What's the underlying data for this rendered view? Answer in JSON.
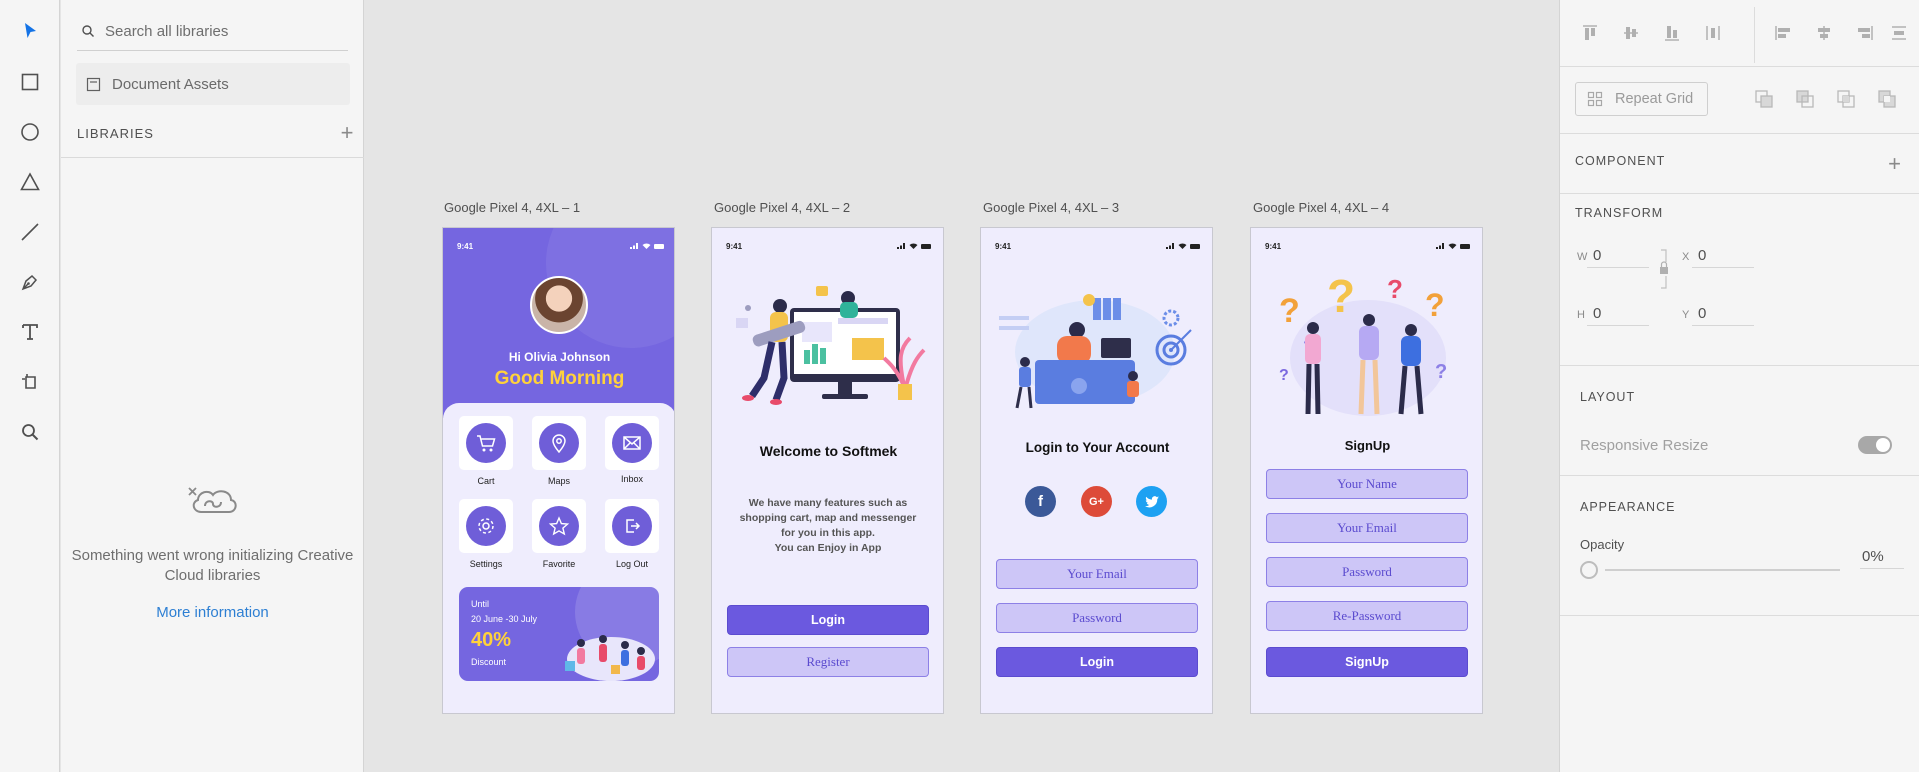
{
  "toolbar": {
    "tools": [
      {
        "name": "select-tool",
        "icon": "arrow-pointer-icon"
      },
      {
        "name": "rectangle-tool",
        "icon": "rectangle-icon"
      },
      {
        "name": "ellipse-tool",
        "icon": "ellipse-icon"
      },
      {
        "name": "polygon-tool",
        "icon": "triangle-icon"
      },
      {
        "name": "line-tool",
        "icon": "line-icon"
      },
      {
        "name": "pen-tool",
        "icon": "pen-icon"
      },
      {
        "name": "text-tool",
        "icon": "text-icon"
      },
      {
        "name": "artboard-tool",
        "icon": "artboard-icon"
      },
      {
        "name": "zoom-tool",
        "icon": "magnifier-icon"
      }
    ],
    "active_color": "#1473e6"
  },
  "libraries": {
    "search_placeholder": "Search all libraries",
    "document_assets": "Document Assets",
    "title": "LIBRARIES",
    "add": "+",
    "error_message": "Something went wrong initializing Creative Cloud libraries",
    "more_info": "More information"
  },
  "artboards": [
    {
      "label": "Google Pixel 4, 4XL – 1",
      "time": "9:41",
      "greeting": "Hi Olivia Johnson",
      "headline": "Good Morning",
      "tiles": [
        {
          "label": "Cart",
          "icon": "cart-icon"
        },
        {
          "label": "Maps",
          "icon": "map-pin-icon"
        },
        {
          "label": "Inbox",
          "icon": "mail-icon"
        },
        {
          "label": "Settings",
          "icon": "gear-icon"
        },
        {
          "label": "Favorite",
          "icon": "star-icon"
        },
        {
          "label": "Log Out",
          "icon": "logout-icon"
        }
      ],
      "promo": {
        "line1": "Until",
        "line2": "20 June -30 July",
        "percent": "40%",
        "line3": "Discount"
      }
    },
    {
      "label": "Google Pixel 4, 4XL – 2",
      "time": "9:41",
      "title": "Welcome to Softmek",
      "body": [
        "We have many features such as",
        "shopping cart, map and messenger",
        "for you in this app.",
        "You can Enjoy in App"
      ],
      "buttons": [
        "Login",
        "Register"
      ]
    },
    {
      "label": "Google Pixel 4, 4XL – 3",
      "time": "9:41",
      "title": "Login to Your Account",
      "social": [
        "f",
        "G+",
        ""
      ],
      "fields": [
        "Your Email",
        "Password"
      ],
      "button": "Login"
    },
    {
      "label": "Google Pixel 4, 4XL – 4",
      "time": "9:41",
      "title": "SignUp",
      "fields": [
        "Your Name",
        "Your Email",
        "Password",
        "Re-Password"
      ],
      "button": "SignUp"
    }
  ],
  "properties": {
    "repeat_grid": "Repeat Grid",
    "component_title": "COMPONENT",
    "component_add": "+",
    "transform_title": "TRANSFORM",
    "w_label": "W",
    "w_value": "0",
    "x_label": "X",
    "x_value": "0",
    "h_label": "H",
    "h_value": "0",
    "y_label": "Y",
    "y_value": "0",
    "layout_title": "LAYOUT",
    "responsive_resize": "Responsive Resize",
    "responsive_resize_on": false,
    "appearance_title": "APPEARANCE",
    "opacity_label": "Opacity",
    "opacity_value": "0%"
  },
  "colors": {
    "brand_purple": "#6b59df",
    "light_purple": "#cdc6f7",
    "screen_bg": "#efedfd",
    "accent_yellow": "#ffd23a",
    "link_blue": "#2d7fd3"
  }
}
